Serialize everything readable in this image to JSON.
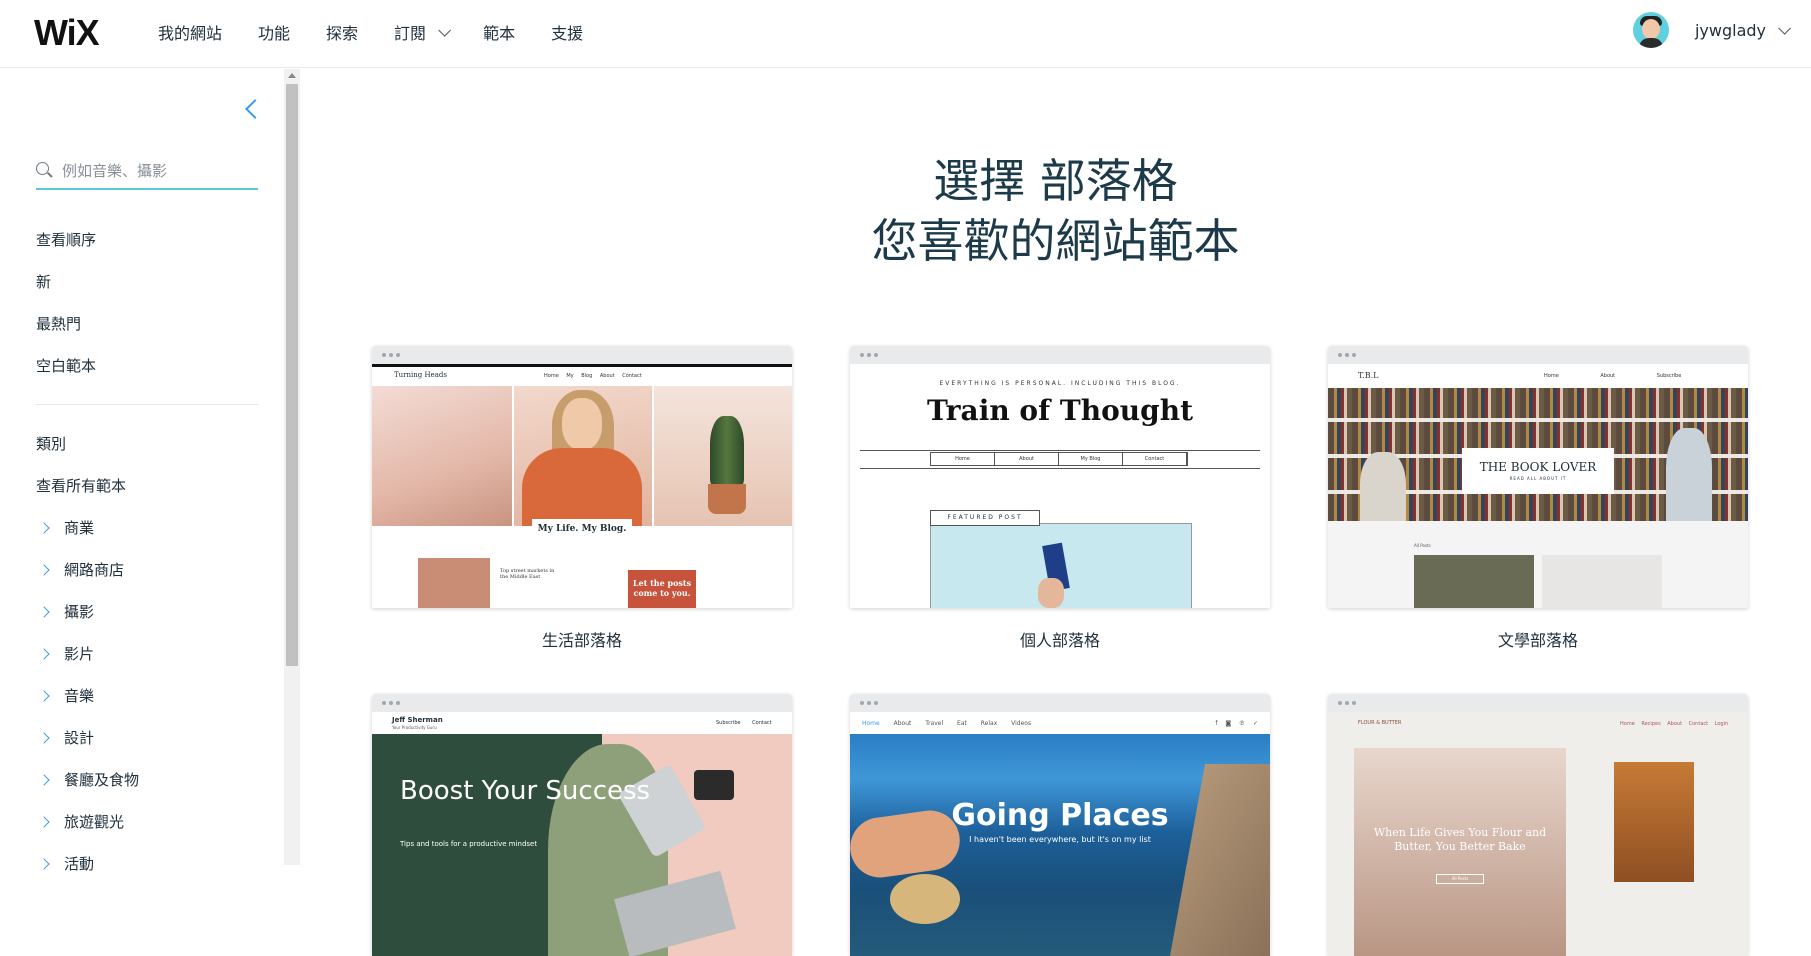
{
  "header": {
    "logo": "WiX",
    "nav": [
      {
        "label": "我的網站"
      },
      {
        "label": "功能"
      },
      {
        "label": "探索"
      },
      {
        "label": "訂閱"
      },
      {
        "label": "範本"
      },
      {
        "label": "支援"
      }
    ],
    "username": "jywglady"
  },
  "sidebar": {
    "search_placeholder": "例如音樂、攝影",
    "sort_links": [
      "查看順序",
      "新",
      "最熱門",
      "空白範本"
    ],
    "categories_heading": "類別",
    "view_all": "查看所有範本",
    "categories": [
      "商業",
      "網路商店",
      "攝影",
      "影片",
      "音樂",
      "設計",
      "餐廳及食物",
      "旅遊觀光",
      "活動"
    ]
  },
  "main": {
    "title_line1": "選擇 部落格",
    "title_line2": "您喜歡的網站範本",
    "templates": [
      {
        "caption": "生活部落格",
        "preview": {
          "brand": "Turning Heads",
          "links": "Home My Blog About Contact",
          "tag": "My Life. My Blog.",
          "post": "Top street markets in the Middle East",
          "cta": "Let the posts come to you."
        }
      },
      {
        "caption": "個人部落格",
        "preview": {
          "top": "EVERYTHING IS PERSONAL. INCLUDING THIS BLOG.",
          "title": "Train of Thought",
          "nav": [
            "Home",
            "About",
            "My Blog",
            "Contact"
          ],
          "featured": "FEATURED POST"
        }
      },
      {
        "caption": "文學部落格",
        "preview": {
          "brand": "T.B.L",
          "links": "Home About Subscribe",
          "box_title": "THE BOOK LOVER",
          "box_sub": "READ ALL ABOUT IT",
          "all_posts": "All Posts"
        }
      },
      {
        "caption": "",
        "preview": {
          "name": "Jeff Sherman",
          "sub": "Your Productivity Guru",
          "links": "Subscribe Contact",
          "title": "Boost Your Success",
          "small": "Tips and tools for a productive mindset"
        }
      },
      {
        "caption": "",
        "preview": {
          "active_link": "Home",
          "links": "About Travel Eat Relax Videos",
          "title": "Going Places",
          "sub": "I haven't been everywhere, but it's on my list"
        }
      },
      {
        "caption": "",
        "preview": {
          "brand": "FLOUR & BUTTER",
          "links": "Home Recipes About Contact Login",
          "text": "When Life Gives You Flour and Butter, You Better Bake",
          "btn": "All Posts"
        }
      }
    ]
  },
  "colors": {
    "accent": "#3899ec",
    "search_underline": "#5ac8d8",
    "title": "#1d3a4a"
  }
}
